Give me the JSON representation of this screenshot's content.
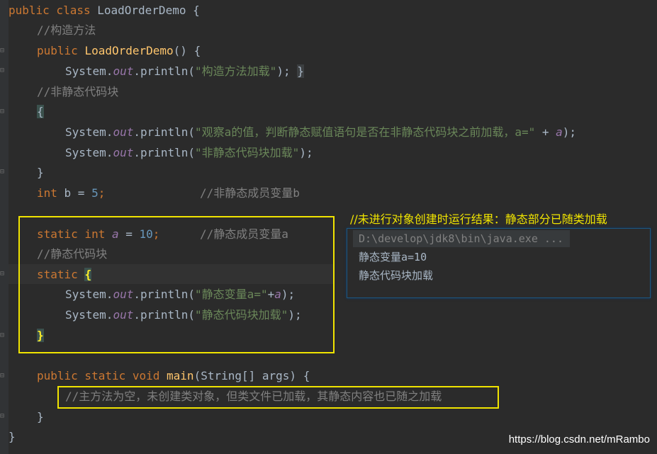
{
  "editor": {
    "lines": {
      "class_decl": {
        "kw": "public class",
        "name": "LoadOrderDemo {"
      },
      "ctor_comment": "//构造方法",
      "ctor_decl": {
        "kw": "public",
        "name": "LoadOrderDemo",
        "rest": "() {"
      },
      "ctor_body": {
        "pre": "System.",
        "out": "out",
        "mid": ".println(",
        "str": "\"构造方法加载\"",
        "end": ");",
        "brace": "}"
      },
      "inst_comment": "//非静态代码块",
      "inst_open": "{",
      "inst_line1": {
        "pre": "System.",
        "out": "out",
        "mid": ".println(",
        "str": "\"观察a的值，判断静态赋值语句是否在非静态代码块之前加载，a=\"",
        "plus": " + ",
        "var": "a",
        "end": ");"
      },
      "inst_line2": {
        "pre": "System.",
        "out": "out",
        "mid": ".println(",
        "str": "\"非静态代码块加载\"",
        "end": ");"
      },
      "inst_close": "}",
      "field_b": {
        "kw": "int",
        "rest": " b = ",
        "num": "5",
        "semi": ";",
        "comment": "//非静态成员变量b"
      },
      "field_a": {
        "kw": "static int",
        "var": "a",
        "eq": " = ",
        "num": "10",
        "semi": ";",
        "comment": "//静态成员变量a"
      },
      "static_comment": "//静态代码块",
      "static_open": {
        "kw": "static",
        "brace": "{"
      },
      "static_line1": {
        "pre": "System.",
        "out": "out",
        "mid": ".println(",
        "str": "\"静态变量a=\"",
        "plus": "+",
        "var": "a",
        "end": ");"
      },
      "static_line2": {
        "pre": "System.",
        "out": "out",
        "mid": ".println(",
        "str": "\"静态代码块加载\"",
        "end": ");"
      },
      "static_close": "}",
      "main_decl": {
        "kw": "public static void",
        "name": "main",
        "rest": "(String[] args) {"
      },
      "main_comment": "//主方法为空，未创建类对象，但类文件已加载，其静态内容也已随之加载",
      "main_close": "}",
      "class_close": "}"
    }
  },
  "annotation": {
    "label": "//未进行对象创建时运行结果：静态部分已随类加载"
  },
  "console": {
    "command": "D:\\develop\\jdk8\\bin\\java.exe ...",
    "output": [
      "静态变量a=10",
      "静态代码块加载"
    ]
  },
  "watermark": "https://blog.csdn.net/mRambo",
  "colors": {
    "background": "#2b2b2b",
    "keyword": "#cc7832",
    "string": "#6a8759",
    "comment": "#808080",
    "number": "#6897bb",
    "highlight_box": "#f0e400"
  }
}
